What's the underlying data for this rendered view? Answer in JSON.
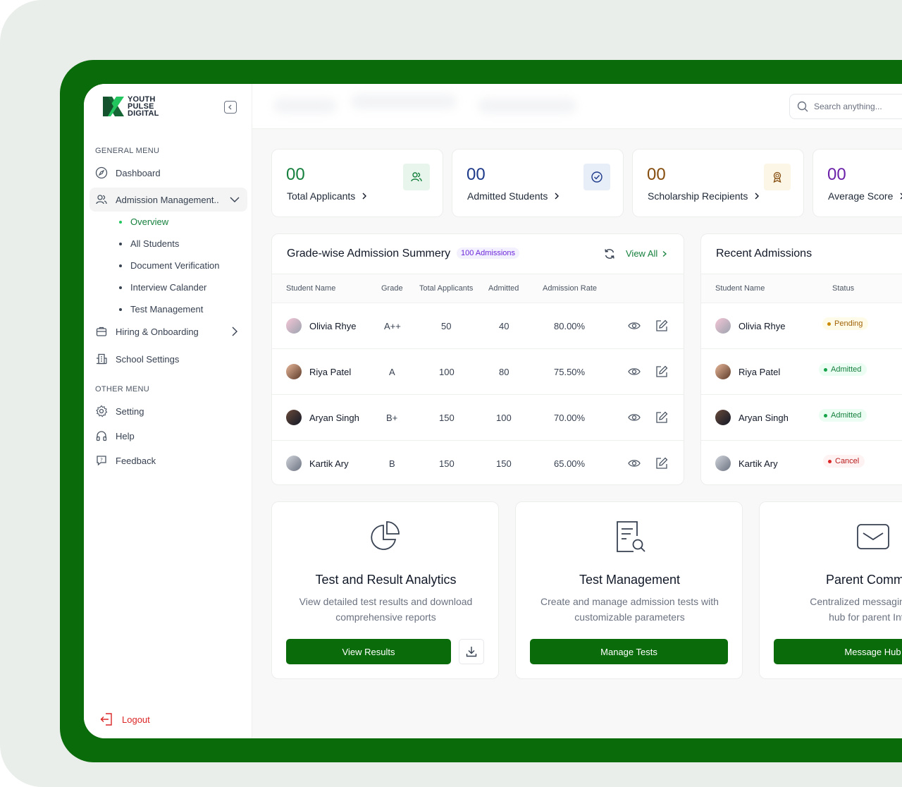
{
  "brand": {
    "line1": "YOUTH",
    "line2": "PULSE",
    "line3": "DIGITAL"
  },
  "sidebar": {
    "general_label": "GENERAL MENU",
    "other_label": "OTHER MENU",
    "items": {
      "dashboard": "Dashboard",
      "admission": "Admission Management..",
      "hiring": "Hiring & Onboarding",
      "school": "School Settings",
      "setting": "Setting",
      "help": "Help",
      "feedback": "Feedback"
    },
    "sub_items": [
      "Overview",
      "All Students",
      "Document Verification",
      "Interview Calander",
      "Test Management"
    ],
    "logout": "Logout"
  },
  "header": {
    "search_placeholder": "Search anything..."
  },
  "stats": [
    {
      "value": "00",
      "label": "Total Applicants",
      "color": "#15803d",
      "icon": "users-icon"
    },
    {
      "value": "00",
      "label": "Admitted Students",
      "color": "#1e3a8a",
      "icon": "check-circle-icon"
    },
    {
      "value": "00",
      "label": "Scholarship Recipients",
      "color": "#854d0e",
      "icon": "award-icon"
    },
    {
      "value": "00",
      "label": "Average Score",
      "color": "#6b21a8",
      "icon": "score-icon"
    }
  ],
  "grade_table": {
    "title": "Grade-wise Admission Summery",
    "badge": "100 Admissions",
    "view_all": "View All",
    "headers": [
      "Student Name",
      "Grade",
      "Total Applicants",
      "Admitted",
      "Admission Rate"
    ],
    "rows": [
      {
        "name": "Olivia Rhye",
        "grade": "A++",
        "total": "50",
        "admitted": "40",
        "rate": "80.00%"
      },
      {
        "name": "Riya Patel",
        "grade": "A",
        "total": "100",
        "admitted": "80",
        "rate": "75.50%"
      },
      {
        "name": "Aryan Singh",
        "grade": "B+",
        "total": "150",
        "admitted": "100",
        "rate": "70.00%"
      },
      {
        "name": "Kartik Ary",
        "grade": "B",
        "total": "150",
        "admitted": "150",
        "rate": "65.00%"
      }
    ]
  },
  "recent": {
    "title": "Recent Admissions",
    "headers": [
      "Student Name",
      "Status"
    ],
    "rows": [
      {
        "name": "Olivia Rhye",
        "status": "Pending"
      },
      {
        "name": "Riya Patel",
        "status": "Admitted"
      },
      {
        "name": "Aryan Singh",
        "status": "Admitted"
      },
      {
        "name": "Kartik Ary",
        "status": "Cancel"
      }
    ]
  },
  "features": [
    {
      "title": "Test and Result Analytics",
      "desc1": "View detailed test results and download",
      "desc2": "comprehensive reports",
      "button": "View Results"
    },
    {
      "title": "Test Management",
      "desc1": "Create and manage admission tests with",
      "desc2": "customizable parameters",
      "button": "Manage Tests"
    },
    {
      "title": "Parent Communi",
      "desc1": "Centralized messaging and c",
      "desc2": "hub for parent Intera",
      "button": "Message Hub"
    }
  ],
  "colors": {
    "brand_green": "#0a6b0a",
    "accent_green": "#15803d",
    "pending": "#ca8a04",
    "admitted": "#16a34a",
    "cancel": "#dc2626"
  }
}
